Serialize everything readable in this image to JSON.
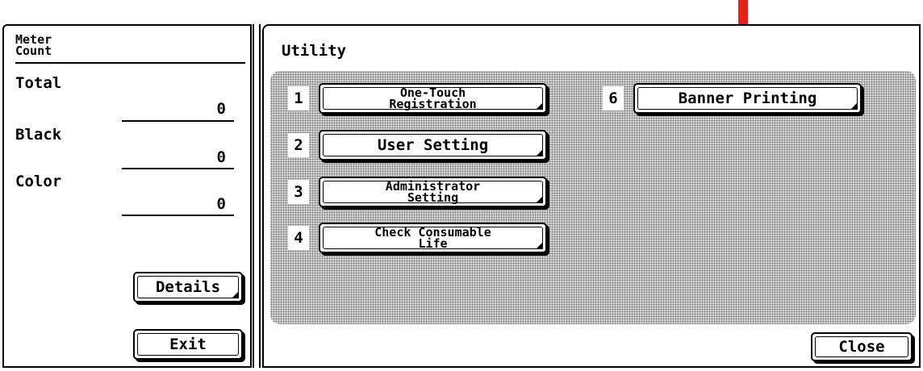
{
  "meter": {
    "title": "Meter\nCount",
    "counters": [
      {
        "label": "Total",
        "value": "0"
      },
      {
        "label": "Black",
        "value": "0"
      },
      {
        "label": "Color",
        "value": "0"
      }
    ],
    "details_label": "Details",
    "exit_label": "Exit"
  },
  "utility": {
    "title": "Utility",
    "items": [
      {
        "number": "1",
        "label": "One-Touch\nRegistration"
      },
      {
        "number": "2",
        "label": "User Setting"
      },
      {
        "number": "3",
        "label": "Administrator\nSetting"
      },
      {
        "number": "4",
        "label": "Check Consumable\nLife"
      },
      {
        "number": "6",
        "label": "Banner Printing"
      }
    ],
    "close_label": "Close"
  },
  "colors": {
    "arrow": "#e2231a",
    "pattern": "#d4d4d4"
  },
  "icons": {
    "annotation": "down-arrow-icon"
  }
}
